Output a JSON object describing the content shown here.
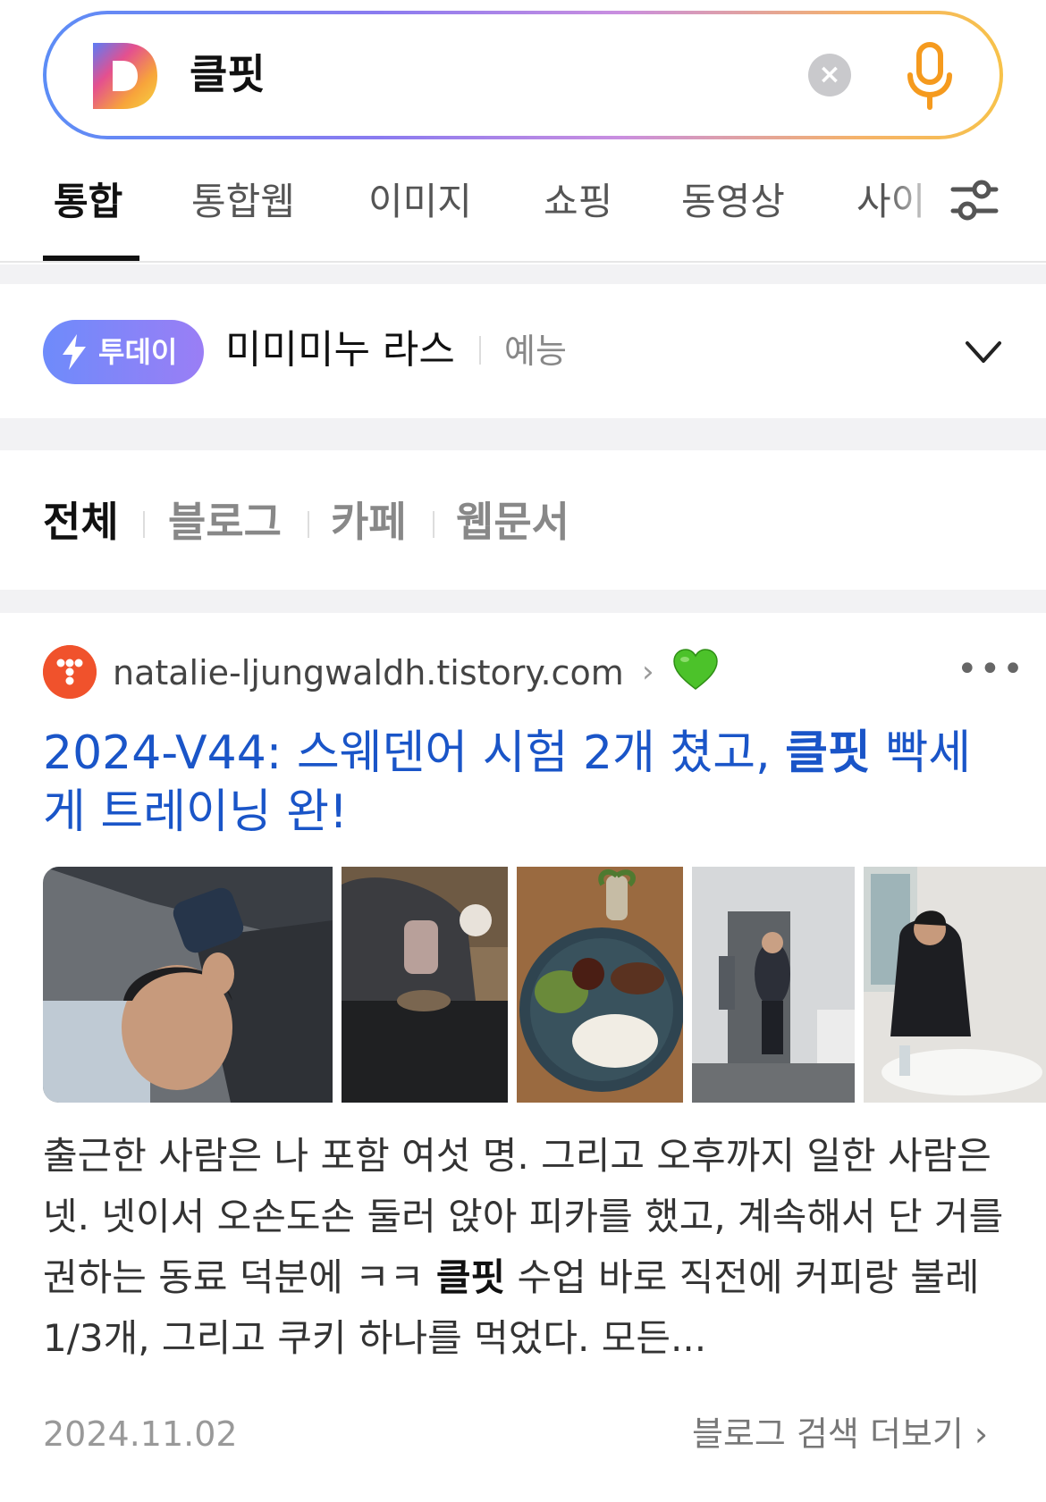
{
  "search": {
    "query": "클핏",
    "clear_icon": "close-icon",
    "mic_icon": "microphone-icon",
    "colors": {
      "gradient_start": "#5c8df6",
      "gradient_end": "#f7c24a"
    }
  },
  "tabs": [
    {
      "label": "통합",
      "active": true
    },
    {
      "label": "통합웹"
    },
    {
      "label": "이미지"
    },
    {
      "label": "쇼핑"
    },
    {
      "label": "동영상"
    },
    {
      "label": "사이"
    }
  ],
  "today": {
    "badge": "투데이",
    "title": "미미미누 라스",
    "category": "예능"
  },
  "filters": [
    "전체",
    "블로그",
    "카페",
    "웹문서"
  ],
  "result": {
    "site": "natalie-ljungwaldh.tistory.com",
    "title_pre": "2024-V44: 스웨덴어 시험 2개 쳤고, ",
    "title_highlight": "클핏",
    "title_post": " 빡세게 트레이닝 완!",
    "snippet_pre": "출근한 사람은 나 포함 여섯 명. 그리고 오후까지 일한 사람은 넷. 넷이서 오손도손 둘러 앉아 피카를 했고, 계속해서 단 거를 권하는 동료 덕분에 ㅋㅋ ",
    "snippet_highlight": "클핏",
    "snippet_post": " 수업 바로 직전에 커피랑 불레 1/3개, 그리고 쿠키 하나를 먹었다. 모든...",
    "date": "2024.11.02",
    "more_link": "블로그 검색 더보기",
    "link_color": "#1a55c8"
  }
}
